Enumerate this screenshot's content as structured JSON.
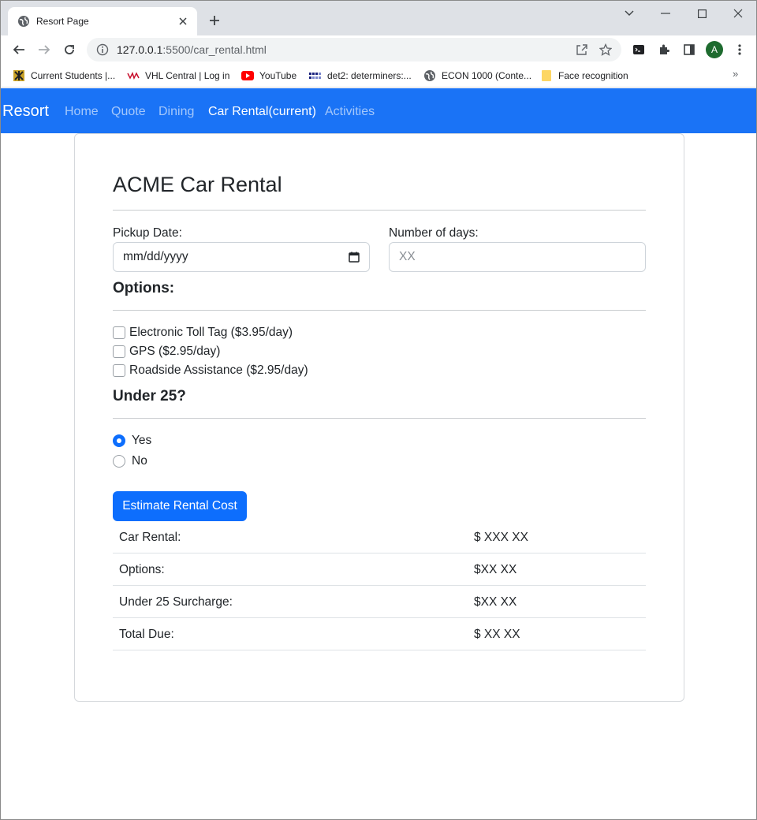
{
  "browser": {
    "tab_title": "Resort Page",
    "url_host": "127.0.0.1",
    "url_path": ":5500/car_rental.html",
    "profile_initial": "A",
    "bookmarks": [
      {
        "label": "Current Students |...",
        "icon": "school-logo-icon"
      },
      {
        "label": "VHL Central | Log in",
        "icon": "vhl-logo-icon"
      },
      {
        "label": "YouTube",
        "icon": "youtube-icon"
      },
      {
        "label": "det2: determiners:...",
        "icon": "grid-logo-icon"
      },
      {
        "label": "ECON 1000 (Conte...",
        "icon": "globe-icon"
      },
      {
        "label": "Face recognition",
        "icon": "folder-icon"
      }
    ],
    "more_bookmarks": "»"
  },
  "navbar": {
    "brand": "Resort",
    "links": [
      "Home",
      "Quote",
      "Dining",
      "Car Rental(current)",
      "Activities"
    ],
    "active_index": 3,
    "color": "#1a73f6"
  },
  "form": {
    "title": "ACME Car Rental",
    "pickup_label": "Pickup Date:",
    "pickup_value": "mm/dd/yyyy",
    "days_label": "Number of days:",
    "days_placeholder": "XX",
    "options_heading": "Options:",
    "options": [
      {
        "label": "Electronic Toll Tag ($3.95/day)",
        "checked": false
      },
      {
        "label": "GPS ($2.95/day)",
        "checked": false
      },
      {
        "label": "Roadside Assistance ($2.95/day)",
        "checked": false
      }
    ],
    "age_heading": "Under 25?",
    "age_options": [
      {
        "label": "Yes",
        "checked": true
      },
      {
        "label": "No",
        "checked": false
      }
    ],
    "submit_label": "Estimate Rental Cost",
    "button_color": "#0d6efd"
  },
  "results": [
    {
      "label": "Car Rental:",
      "value": "$ XXX XX"
    },
    {
      "label": "Options:",
      "value": "$XX XX"
    },
    {
      "label": "Under 25 Surcharge:",
      "value": "$XX XX"
    },
    {
      "label": "Total Due:",
      "value": "$ XX XX"
    }
  ]
}
